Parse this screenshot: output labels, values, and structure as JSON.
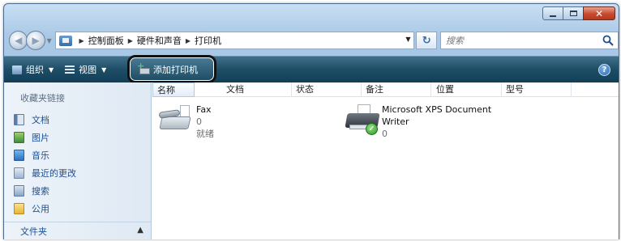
{
  "window": {
    "caption_buttons": [
      "minimize",
      "maximize",
      "close"
    ]
  },
  "address": {
    "breadcrumbs": [
      "控制面板",
      "硬件和声音",
      "打印机"
    ],
    "search_placeholder": "搜索"
  },
  "toolbar": {
    "organize_label": "组织",
    "views_label": "视图",
    "add_printer_label": "添加打印机",
    "help_label": "?"
  },
  "nav_pane": {
    "heading": "收藏夹链接",
    "items": [
      {
        "label": "文档",
        "icon": "document-icon"
      },
      {
        "label": "图片",
        "icon": "pictures-icon"
      },
      {
        "label": "音乐",
        "icon": "music-icon"
      },
      {
        "label": "最近的更改",
        "icon": "recent-icon"
      },
      {
        "label": "搜索",
        "icon": "search-folder-icon"
      },
      {
        "label": "公用",
        "icon": "public-folder-icon"
      }
    ],
    "folders_label": "文件夹"
  },
  "columns": [
    "名称",
    "文档",
    "状态",
    "备注",
    "位置",
    "型号"
  ],
  "printers": [
    {
      "name": "Fax",
      "documents": "0",
      "status": "就绪",
      "icon": "fax-icon"
    },
    {
      "name_line1": "Microsoft XPS Document",
      "name_line2": "Writer",
      "documents": "0",
      "icon": "printer-default-icon"
    }
  ],
  "colors": {
    "toolbar_bg": "#1e4d66",
    "nav_link": "#1c4f95",
    "highlight_border": "#111111"
  }
}
